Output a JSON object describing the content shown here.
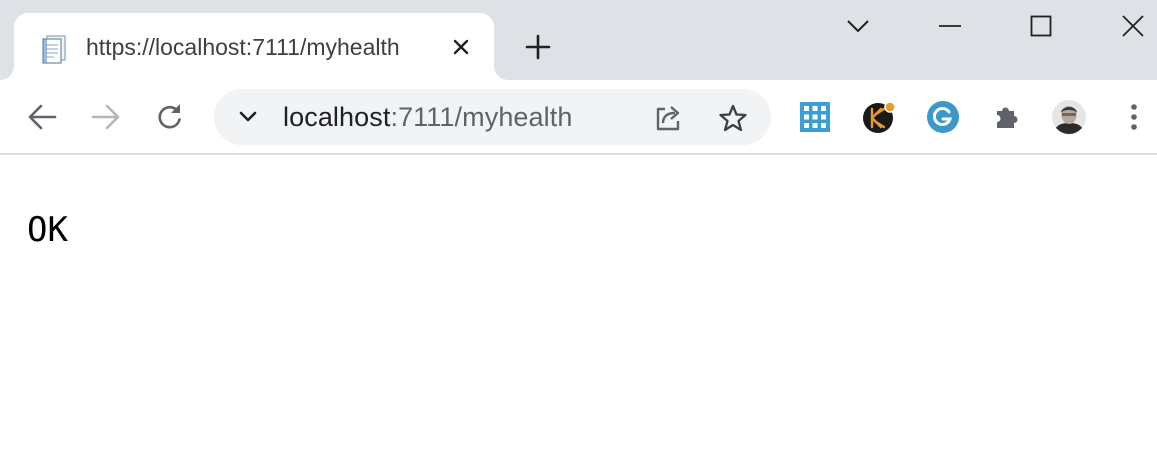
{
  "tab": {
    "title": "https://localhost:7111/myhealth",
    "favicon": "document-page-icon"
  },
  "new_tab_icon": "plus-icon",
  "window_controls": [
    "tab-search-chevron-icon",
    "minimize-icon",
    "maximize-icon",
    "close-icon"
  ],
  "toolbar": {
    "back_icon": "arrow-left-icon",
    "forward_icon": "arrow-right-icon",
    "reload_icon": "reload-icon"
  },
  "omnibox": {
    "host": "localhost",
    "path": ":7111/myhealth",
    "share_icon": "share-icon",
    "bookmark_icon": "star-icon"
  },
  "extensions": [
    "grid-app-icon",
    "keeper-icon",
    "grammarly-icon",
    "puzzle-extensions-icon",
    "profile-avatar"
  ],
  "page": {
    "body_text": "OK"
  },
  "colors": {
    "tabstrip_bg": "#dee1e6",
    "omnibox_bg": "#f1f3f4",
    "grid_ext": "#3b9fd4",
    "grammarly": "#3a99c9",
    "keeper": "#e89a2c"
  }
}
